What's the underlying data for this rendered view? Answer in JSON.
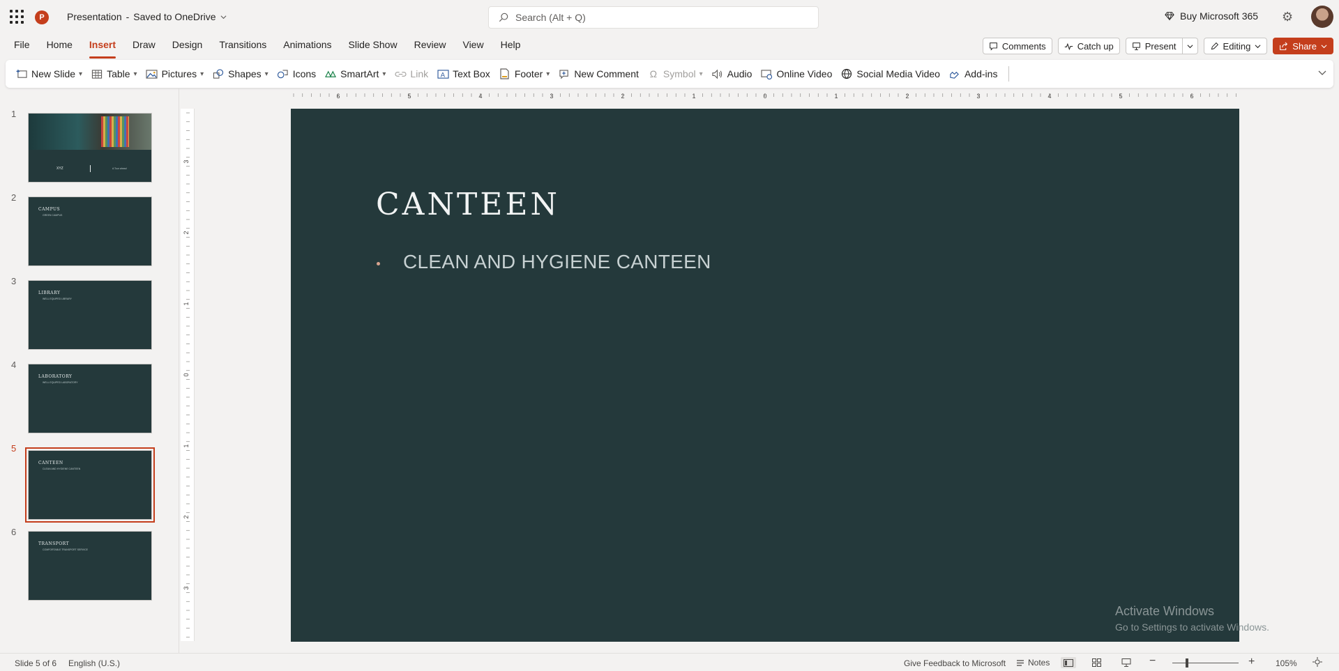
{
  "titlebar": {
    "app_letter": "P",
    "doc_name": "Presentation",
    "separator": "-",
    "save_status": "Saved to OneDrive",
    "search_placeholder": "Search (Alt + Q)",
    "buy_label": "Buy Microsoft 365"
  },
  "menu": {
    "tabs": [
      "File",
      "Home",
      "Insert",
      "Draw",
      "Design",
      "Transitions",
      "Animations",
      "Slide Show",
      "Review",
      "View",
      "Help"
    ],
    "active_tab": "Insert",
    "comments": "Comments",
    "catch_up": "Catch up",
    "present": "Present",
    "editing": "Editing",
    "share": "Share"
  },
  "ribbon": {
    "new_slide": "New Slide",
    "table": "Table",
    "pictures": "Pictures",
    "shapes": "Shapes",
    "icons": "Icons",
    "smartart": "SmartArt",
    "link": "Link",
    "text_box": "Text Box",
    "footer": "Footer",
    "new_comment": "New Comment",
    "symbol": "Symbol",
    "audio": "Audio",
    "online_video": "Online Video",
    "social_media_video": "Social Media Video",
    "add_ins": "Add-ins"
  },
  "thumbnails": [
    {
      "num": "1",
      "title": "",
      "bullet": "",
      "name": "XYZ",
      "sub": "A Tour ahead"
    },
    {
      "num": "2",
      "title": "CAMPUS",
      "bullet": "GREEN CAMPUS"
    },
    {
      "num": "3",
      "title": "LIBRARY",
      "bullet": "WELL EQUIPED LIBRARY"
    },
    {
      "num": "4",
      "title": "LABORATORY",
      "bullet": "WELL EQUIPED LABORATORY"
    },
    {
      "num": "5",
      "title": "CANTEEN",
      "bullet": "CLEAN AND HYGIENE CANTEEN"
    },
    {
      "num": "6",
      "title": "TRANSPORT",
      "bullet": "COMFORTABLE TRANSPORT SERVICE"
    }
  ],
  "active_slide": 5,
  "slide": {
    "title": "CANTEEN",
    "bullet": "CLEAN AND HYGIENE CANTEEN"
  },
  "watermark": {
    "line1": "Activate Windows",
    "line2": "Go to Settings to activate Windows."
  },
  "ruler": {
    "h_labels": [
      "6",
      "5",
      "4",
      "3",
      "2",
      "1",
      "0",
      "1",
      "2",
      "3",
      "4",
      "5",
      "6"
    ],
    "v_labels": [
      "3",
      "2",
      "1",
      "0",
      "1",
      "2",
      "3"
    ]
  },
  "status": {
    "slide_count": "Slide 5 of 6",
    "language": "English (U.S.)",
    "feedback": "Give Feedback to Microsoft",
    "notes": "Notes",
    "zoom": "105%"
  },
  "colors": {
    "accent": "#c43e1c",
    "slide_bg": "#24393b"
  }
}
